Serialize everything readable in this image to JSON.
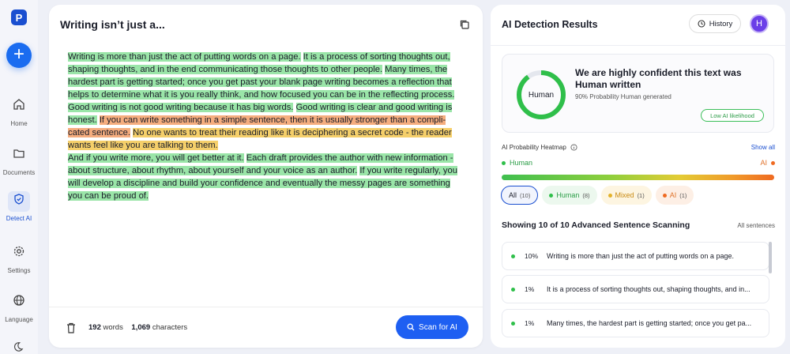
{
  "sidebar": {
    "logo": "P",
    "new_button": "+",
    "items": [
      {
        "label": "Home",
        "icon": "home-icon"
      },
      {
        "label": "Documents",
        "icon": "folder-icon"
      },
      {
        "label": "Detect AI",
        "icon": "shield-icon",
        "active": true
      },
      {
        "label": "Settings",
        "icon": "gear-icon"
      },
      {
        "label": "Language",
        "icon": "globe-icon"
      }
    ]
  },
  "editor": {
    "title": "Writing isn’t just a...",
    "paragraph1": [
      {
        "text": "Writing is more than just the act of putting words on a page.",
        "hl": "green"
      },
      {
        "text": " ",
        "hl": ""
      },
      {
        "text": "It is a process of sorting thoughts out, shaping thoughts, and in the end communicating those thoughts to other people.",
        "hl": "green"
      },
      {
        "text": " ",
        "hl": ""
      },
      {
        "text": "Many times, the hardest part is getting started; once you get past your blank page writing becomes a reflection that helps to determine what it is you really think, and how focused you can be in the reflecting process.",
        "hl": "green"
      },
      {
        "text": " ",
        "hl": ""
      },
      {
        "text": "Good writing is not good writing because it has big words.",
        "hl": "green"
      },
      {
        "text": " ",
        "hl": ""
      },
      {
        "text": "Good writing is clear and good writing is honest.",
        "hl": "green"
      },
      {
        "text": " ",
        "hl": ""
      },
      {
        "text": "If you can write something in a simple sentence, then it is usually stronger than a compli-cated sentence.",
        "hl": "orange"
      },
      {
        "text": " ",
        "hl": ""
      },
      {
        "text": "No one wants to treat their reading like it is deciphering a secret code - the reader wants feel like you are talking to them.",
        "hl": "yellow"
      }
    ],
    "paragraph2": [
      {
        "text": "And if you write more, you will get better at it.",
        "hl": "green"
      },
      {
        "text": " ",
        "hl": ""
      },
      {
        "text": "Each draft provides the author with new information - about structure, about rhythm, about yourself and your voice as an author.",
        "hl": "green"
      },
      {
        "text": " ",
        "hl": ""
      },
      {
        "text": "If you write regularly, you will develop a discipline and build your confidence and eventually the messy pages are something you can be proud of.",
        "hl": "green"
      }
    ],
    "word_count": "192",
    "words_label": "words",
    "char_count": "1,069",
    "chars_label": "characters",
    "scan_label": "Scan for AI"
  },
  "results": {
    "title": "AI Detection Results",
    "history_label": "History",
    "avatar_initial": "H",
    "ring_label": "Human",
    "human_probability": 0.9,
    "verdict_heading": "We are highly confident this text was Human written",
    "verdict_sub": "90% Probability Human generated",
    "likelihood_badge": "Low AI likelihood",
    "heatmap_label": "AI Probability Heatmap",
    "show_all": "Show all",
    "legend_human": "Human",
    "legend_ai": "AI",
    "chips": [
      {
        "label": "All",
        "count": "(10)"
      },
      {
        "label": "Human",
        "count": "(8)"
      },
      {
        "label": "Mixed",
        "count": "(1)"
      },
      {
        "label": "AI",
        "count": "(1)"
      }
    ],
    "scan_heading": "Showing 10 of 10 Advanced Sentence Scanning",
    "all_sentences": "All sentences",
    "sentences": [
      {
        "pct": "10%",
        "text": "Writing is more than just the act of putting words on a page."
      },
      {
        "pct": "1%",
        "text": "It is a process of sorting thoughts out, shaping thoughts, and in..."
      },
      {
        "pct": "1%",
        "text": "Many times, the hardest part is getting started; once you get pa..."
      }
    ]
  },
  "colors": {
    "accent": "#1e5ff2",
    "human": "#2fbf4a",
    "mixed": "#e3b22a",
    "ai": "#ef6a21"
  }
}
